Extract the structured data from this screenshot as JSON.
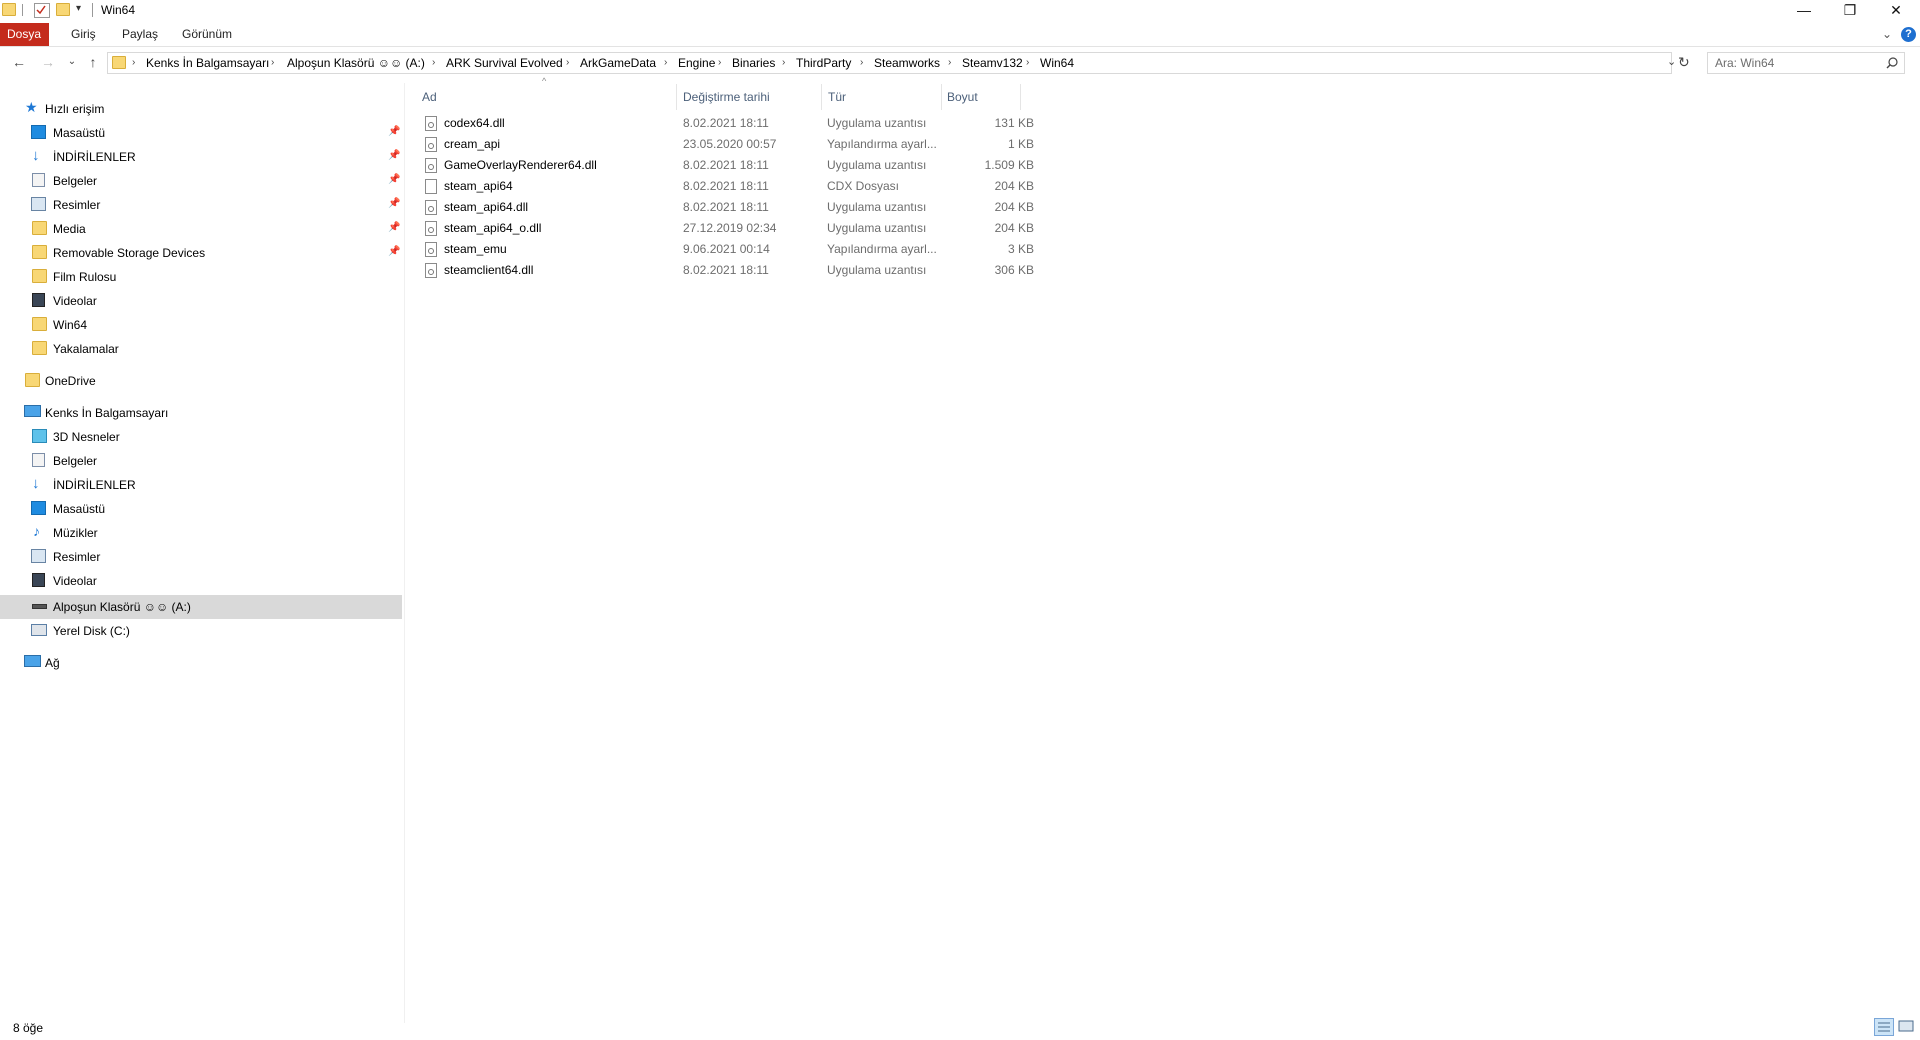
{
  "window": {
    "title": "Win64",
    "minimize_glyph": "—",
    "restore_glyph": "❐",
    "close_glyph": "✕"
  },
  "ribbon": {
    "tabs": [
      "Dosya",
      "Giriş",
      "Paylaş",
      "Görünüm"
    ]
  },
  "address": {
    "crumbs": [
      "Kenks İn Balgamsayarı",
      "Alpoşun Klasörü ☺☺ (A:)",
      "ARK Survival Evolved",
      "ArkGameData",
      "Engine",
      "Binaries",
      "ThirdParty",
      "Steamworks",
      "Steamv132",
      "Win64"
    ]
  },
  "search": {
    "placeholder": "Ara: Win64"
  },
  "nav": {
    "quick_access": "Hızlı erişim",
    "quick_items": [
      "Masaüstü",
      "İNDİRİLENLER",
      "Belgeler",
      "Resimler",
      "Media",
      "Removable Storage Devices",
      "Film Rulosu",
      "Videolar",
      "Win64",
      "Yakalamalar"
    ],
    "onedrive": "OneDrive",
    "this_pc": "Kenks İn Balgamsayarı",
    "pc_items": [
      "3D Nesneler",
      "Belgeler",
      "İNDİRİLENLER",
      "Masaüstü",
      "Müzikler",
      "Resimler",
      "Videolar",
      "Alpoşun Klasörü ☺☺ (A:)",
      "Yerel Disk (C:)"
    ],
    "network": "Ağ"
  },
  "columns": {
    "name": "Ad",
    "date": "Değiştirme tarihi",
    "type": "Tür",
    "size": "Boyut"
  },
  "files": [
    {
      "name": "codex64.dll",
      "date": "8.02.2021 18:11",
      "type": "Uygulama uzantısı",
      "size": "131 KB"
    },
    {
      "name": "cream_api",
      "date": "23.05.2020 00:57",
      "type": "Yapılandırma ayarl...",
      "size": "1 KB"
    },
    {
      "name": "GameOverlayRenderer64.dll",
      "date": "8.02.2021 18:11",
      "type": "Uygulama uzantısı",
      "size": "1.509 KB"
    },
    {
      "name": "steam_api64",
      "date": "8.02.2021 18:11",
      "type": "CDX Dosyası",
      "size": "204 KB"
    },
    {
      "name": "steam_api64.dll",
      "date": "8.02.2021 18:11",
      "type": "Uygulama uzantısı",
      "size": "204 KB"
    },
    {
      "name": "steam_api64_o.dll",
      "date": "27.12.2019 02:34",
      "type": "Uygulama uzantısı",
      "size": "204 KB"
    },
    {
      "name": "steam_emu",
      "date": "9.06.2021 00:14",
      "type": "Yapılandırma ayarl...",
      "size": "3 KB"
    },
    {
      "name": "steamclient64.dll",
      "date": "8.02.2021 18:11",
      "type": "Uygulama uzantısı",
      "size": "306 KB"
    }
  ],
  "status": {
    "count": "8 öğe"
  }
}
